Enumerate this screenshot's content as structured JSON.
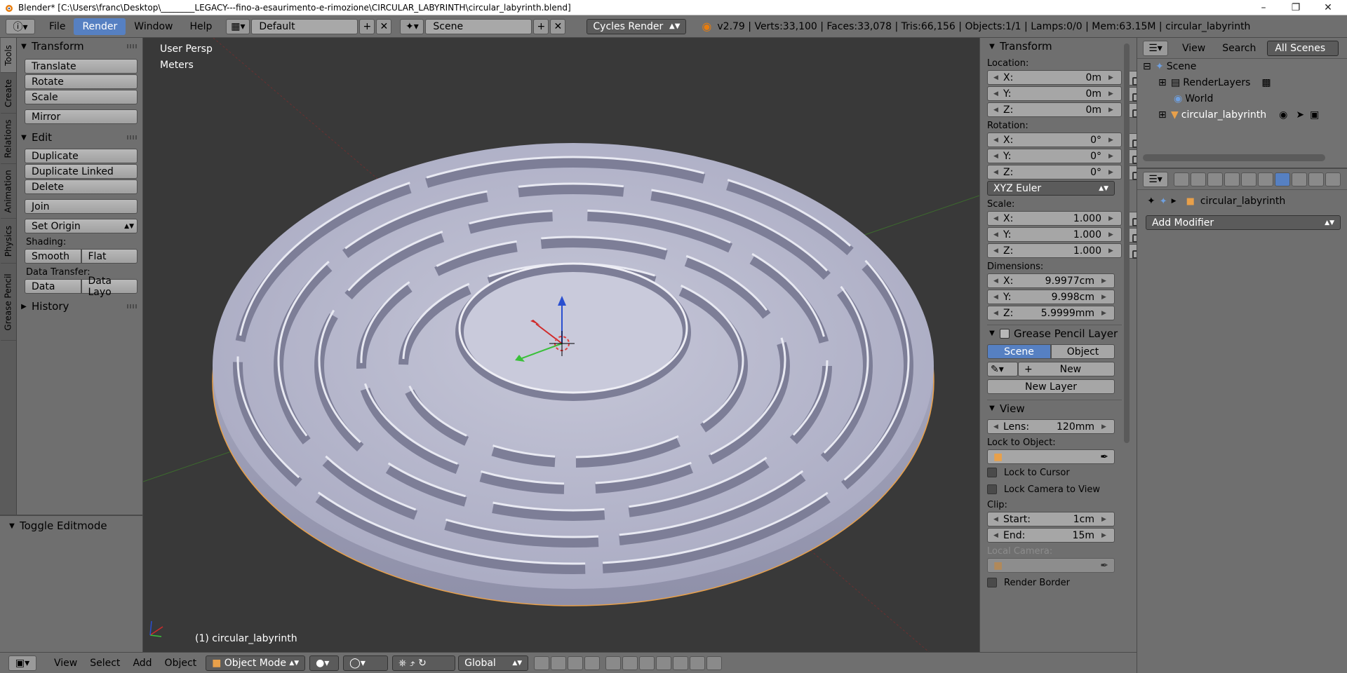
{
  "window": {
    "title": "Blender* [C:\\Users\\franc\\Desktop\\________LEGACY---fino-a-esaurimento-e-rimozione\\CIRCULAR_LABYRINTH\\circular_labyrinth.blend]"
  },
  "infobar": {
    "menus": [
      "File",
      "Render",
      "Window",
      "Help"
    ],
    "active_menu": "Render",
    "layout": "Default",
    "scene": "Scene",
    "engine": "Cycles Render",
    "stats": "v2.79 | Verts:33,100 | Faces:33,078 | Tris:66,156 | Objects:1/1 | Lamps:0/0 | Mem:63.15M | circular_labyrinth"
  },
  "toolshelf": {
    "tabs": [
      "Tools",
      "Create",
      "Relations",
      "Animation",
      "Physics",
      "Grease Pencil"
    ],
    "transform_header": "Transform",
    "transform_buttons": [
      "Translate",
      "Rotate",
      "Scale"
    ],
    "mirror": "Mirror",
    "edit_header": "Edit",
    "edit_buttons": [
      "Duplicate",
      "Duplicate Linked",
      "Delete"
    ],
    "join": "Join",
    "set_origin": "Set Origin",
    "shading_label": "Shading:",
    "smooth": "Smooth",
    "flat": "Flat",
    "data_transfer_label": "Data Transfer:",
    "data": "Data",
    "data_layo": "Data Layo",
    "history_header": "History",
    "operator_header": "Toggle Editmode"
  },
  "viewport": {
    "view_name": "User Persp",
    "units": "Meters",
    "object_label": "(1) circular_labyrinth"
  },
  "npanel": {
    "transform_header": "Transform",
    "location_label": "Location:",
    "location": [
      {
        "k": "X:",
        "v": "0m"
      },
      {
        "k": "Y:",
        "v": "0m"
      },
      {
        "k": "Z:",
        "v": "0m"
      }
    ],
    "rotation_label": "Rotation:",
    "rotation": [
      {
        "k": "X:",
        "v": "0°"
      },
      {
        "k": "Y:",
        "v": "0°"
      },
      {
        "k": "Z:",
        "v": "0°"
      }
    ],
    "rotation_mode": "XYZ Euler",
    "scale_label": "Scale:",
    "scale": [
      {
        "k": "X:",
        "v": "1.000"
      },
      {
        "k": "Y:",
        "v": "1.000"
      },
      {
        "k": "Z:",
        "v": "1.000"
      }
    ],
    "dimensions_label": "Dimensions:",
    "dimensions": [
      {
        "k": "X:",
        "v": "9.9977cm"
      },
      {
        "k": "Y:",
        "v": "9.998cm"
      },
      {
        "k": "Z:",
        "v": "5.9999mm"
      }
    ],
    "grease_header": "Grease Pencil Layer",
    "grease_scene": "Scene",
    "grease_object": "Object",
    "grease_new": "New",
    "grease_new_layer": "New Layer",
    "view_header": "View",
    "lens_label": "Lens:",
    "lens_value": "120mm",
    "lock_object_label": "Lock to Object:",
    "lock_cursor": "Lock to Cursor",
    "lock_camera": "Lock Camera to View",
    "clip_label": "Clip:",
    "clip_start_label": "Start:",
    "clip_start": "1cm",
    "clip_end_label": "End:",
    "clip_end": "15m",
    "local_camera_label": "Local Camera:",
    "render_border": "Render Border"
  },
  "outliner": {
    "view": "View",
    "search": "Search",
    "filter": "All Scenes",
    "items": [
      "Scene",
      "RenderLayers",
      "World",
      "circular_labyrinth"
    ]
  },
  "properties": {
    "object_name": "circular_labyrinth",
    "add_modifier": "Add Modifier"
  },
  "bottombar": {
    "menus": [
      "View",
      "Select",
      "Add",
      "Object"
    ],
    "mode": "Object Mode",
    "orientation": "Global"
  }
}
